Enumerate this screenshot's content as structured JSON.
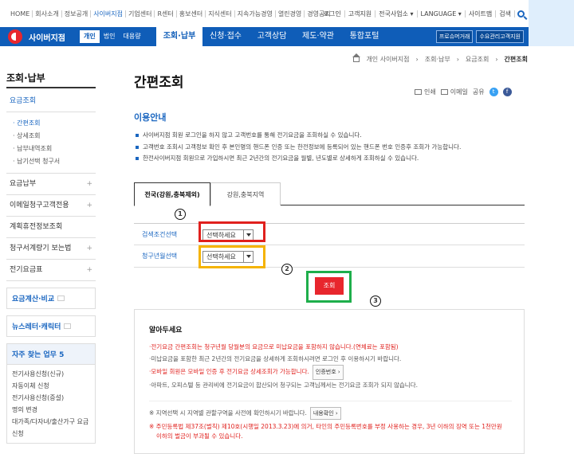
{
  "top_links": [
    "HOME",
    "회사소개",
    "정보공개",
    "사이버지점",
    "기업센터",
    "R센터",
    "홍보센터",
    "지식센터",
    "지속가능경영",
    "열린경영",
    "경영공시"
  ],
  "top_links_active_index": 3,
  "top_right": [
    "로그인",
    "고객지원",
    "전국사업소 ▾",
    "LANGUAGE ▾",
    "사이트맵",
    "검색"
  ],
  "logo_text": "사이버지점",
  "segments": [
    "개인",
    "법인",
    "대용량"
  ],
  "main_nav": [
    "조회·납부",
    "신청·접수",
    "고객상담",
    "제도·약관",
    "통합포털"
  ],
  "nav_buttons": [
    "프로슈머거래",
    "수요관리고객지원"
  ],
  "breadcrumb": [
    "개인 사이버지점",
    "조회·납부",
    "요금조회",
    "간편조회"
  ],
  "sidebar": {
    "title": "조회·납부",
    "sub": "요금조회",
    "sublist": [
      "간편조회",
      "상세조회",
      "납부내역조회",
      "납기선택 청구서"
    ],
    "items": [
      "요금납부",
      "이메일청구고객전용",
      "계획휴전정보조회",
      "청구서계량기 보는법",
      "전기요금표"
    ],
    "box1": "요금계산·비교",
    "box2": "뉴스레터·캐릭터",
    "freq_title": "자주 찾는 업무 5",
    "freq_list": [
      "전기사용신청(신규)",
      "자동이체 신청",
      "전기사용신청(증설)",
      "명의 변경",
      "대가족/다자녀/출산가구 요금 신청"
    ]
  },
  "page_title": "간편조회",
  "share": {
    "print": "인쇄",
    "email": "이메일",
    "share": "공유"
  },
  "info_title": "이용안내",
  "info_list": [
    "사이버지점 회원 로그인을 하지 않고 고객번호를 통해 전기요금을 조회하실 수 있습니다.",
    "고객번호 조회시 고객정보 확인 후 본인명의 핸드폰 인증 또는 한전정보에 등록되어 있는 핸드폰 번호 인증후 조회가 가능합니다.",
    "한전사이버지점 회원으로 가입하시면 최근 2년간의 전기요금을 월별, 년도별로 상세하게 조회하실 수 있습니다."
  ],
  "tabs": [
    "전국(강원,충북제외)",
    "강원,충북지역"
  ],
  "form": {
    "label1": "검색조건선택",
    "select1": "선택하세요",
    "label2": "청구년월선택",
    "select2": "선택하세요"
  },
  "search_button": "조회",
  "markers": [
    "1",
    "2",
    "3"
  ],
  "notice": {
    "title": "알아두세요",
    "items": [
      {
        "text": "전기요금 간편조회는 청구년월 당월분의 요금으로 미납요금을 포함하지 않습니다.(연체료는 포함됨)",
        "color": "red"
      },
      {
        "text": "미납요금을 포함한 최근 2년간의 전기요금을 상세하게 조회하시려면 로그인 후 이용하시기 바랍니다.",
        "color": "gray"
      },
      {
        "text": "모바일 회원은 모바일 인증 후 전기요금 상세조회가 가능합니다.",
        "color": "red",
        "button": "인증번호 ›"
      },
      {
        "text": "아파트, 오피스텔 등 관리비에 전기요금이 합산되어 청구되는 고객님께서는 전기요금 조회가 되지 않습니다.",
        "color": "gray"
      }
    ],
    "foot1": "※ 지역선택 시 지역별 관할구역을 사전에 확인하시기 바랍니다.",
    "foot1_button": "내용확인 ›",
    "foot2a": "※ 주민등록법 제37조(벌칙) 제10호(시행일 2013.3.23)에 의거, 타인의 주민등록번호를 부정 사용하는 경우, 3년 이하의 징역 또는 1천만원",
    "foot2b": "이하의 벌금이 부과될 수 있습니다."
  }
}
